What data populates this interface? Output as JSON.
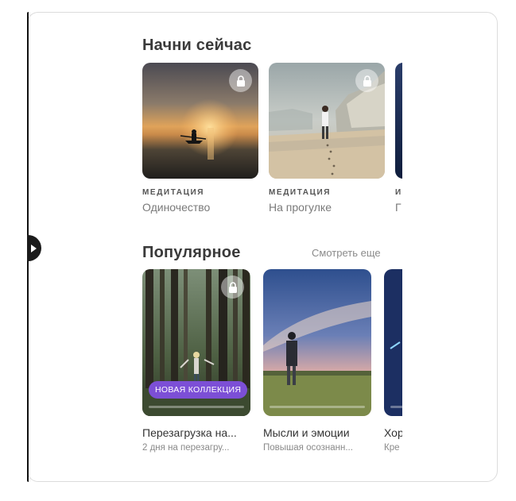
{
  "sections": {
    "start": {
      "title": "Начни сейчас",
      "cards": [
        {
          "category": "МЕДИТАЦИЯ",
          "name": "Одиночество",
          "locked": true,
          "image": "kayaker-at-sunset"
        },
        {
          "category": "МЕДИТАЦИЯ",
          "name": "На прогулке",
          "locked": true,
          "image": "person-walking-on-beach"
        },
        {
          "category": "И",
          "name": "Г",
          "locked": false,
          "image": "night-sky"
        }
      ]
    },
    "popular": {
      "title": "Популярное",
      "see_more": "Смотреть еще",
      "cards": [
        {
          "name": "Перезагрузка на...",
          "subtitle": "2 дня на перезагру...",
          "badge": "НОВАЯ КОЛЛЕКЦИЯ",
          "locked": true,
          "image": "forest-person"
        },
        {
          "name": "Мысли и эмоции",
          "subtitle": "Повышая осознанн...",
          "locked": false,
          "image": "person-in-field-at-dusk"
        },
        {
          "name": "Хор",
          "subtitle": "Кре",
          "locked": false,
          "image": "starry-sky"
        }
      ]
    }
  },
  "colors": {
    "accent": "#7c4fd6",
    "title": "#3a3a3a",
    "muted": "#8a8a8a"
  },
  "icons": {
    "lock": "lock-icon",
    "handle": "play-arrow-icon"
  }
}
